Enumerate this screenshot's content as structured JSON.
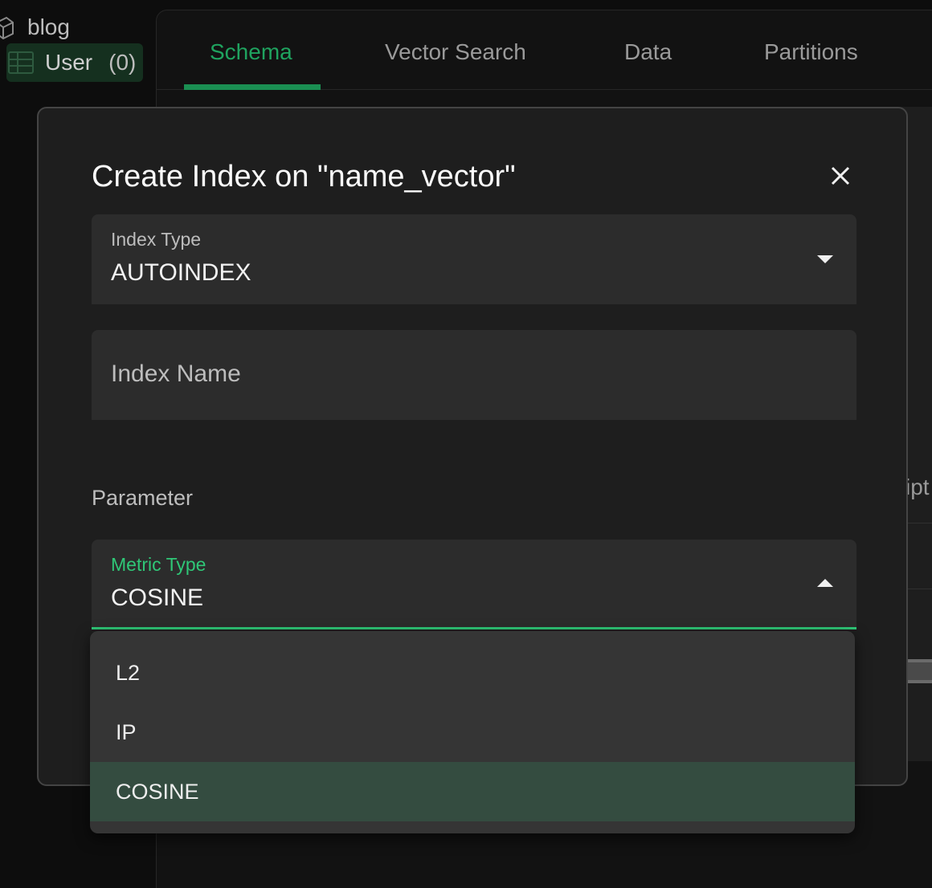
{
  "sidebar": {
    "database": {
      "label": "blog",
      "icon": "cube-icon"
    },
    "collection": {
      "label": "User",
      "count": "(0)",
      "icon": "table-icon"
    }
  },
  "tabs": [
    {
      "label": "Schema",
      "active": true
    },
    {
      "label": "Vector Search",
      "active": false
    },
    {
      "label": "Data",
      "active": false
    },
    {
      "label": "Partitions",
      "active": false
    }
  ],
  "background": {
    "partial_text": "ipt"
  },
  "modal": {
    "title": "Create Index on \"name_vector\"",
    "close_icon": "close-icon",
    "index_type": {
      "label": "Index Type",
      "value": "AUTOINDEX"
    },
    "index_name": {
      "placeholder": "Index Name",
      "value": ""
    },
    "parameter_heading": "Parameter",
    "metric_type": {
      "label": "Metric Type",
      "value": "COSINE",
      "open": true
    }
  },
  "metric_menu": {
    "options": [
      "L2",
      "IP",
      "COSINE"
    ],
    "selected": "COSINE"
  },
  "colors": {
    "accent": "#2fc777",
    "tab_active": "#1fa35f",
    "selected_option_bg": "#344c40",
    "modal_bg": "#1e1e1e"
  }
}
